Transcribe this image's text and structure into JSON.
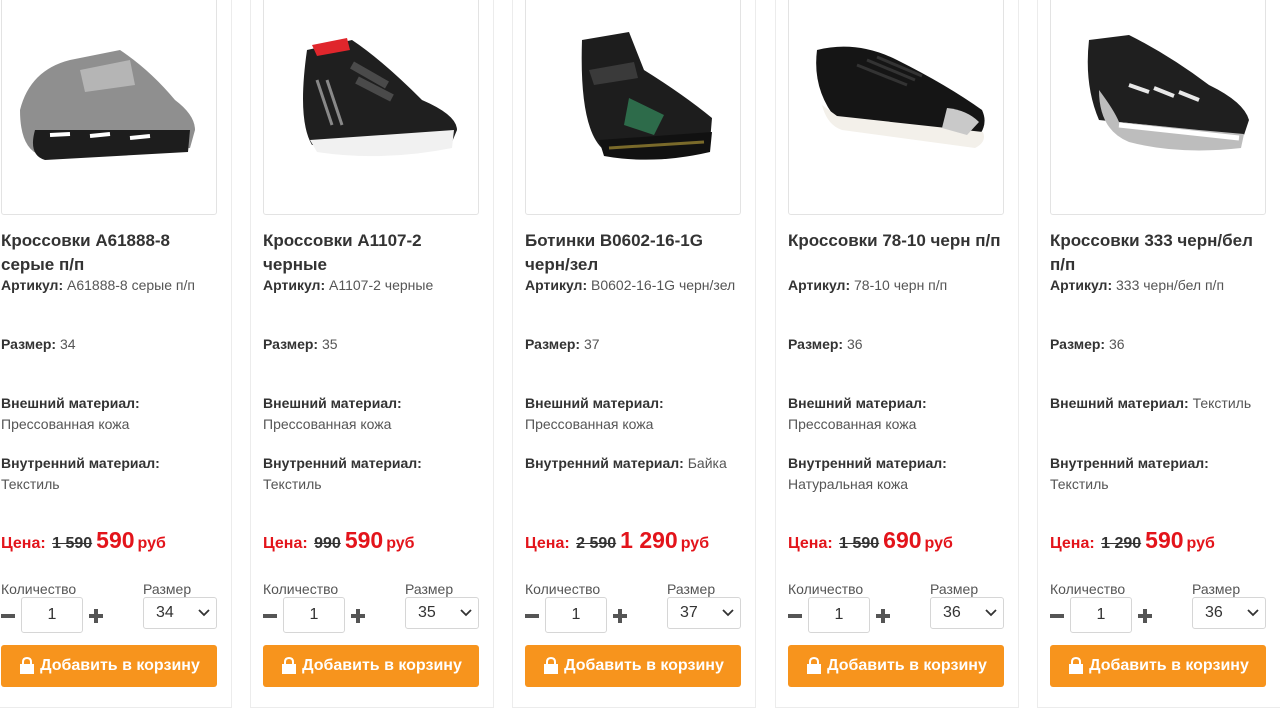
{
  "labels": {
    "article": "Артикул:",
    "size": "Размер:",
    "outer": "Внешний материал:",
    "inner": "Внутренний материал:",
    "price": "Цена:",
    "currency": "руб",
    "qty_label": "Количество",
    "size_label": "Размер",
    "add_to_cart": "Добавить в корзину",
    "bag_icon": "shopping-bag-icon"
  },
  "products": [
    {
      "title": "Кроссовки A61888-8 серые п/п",
      "article": "A61888-8 серые п/п",
      "size": "34",
      "outer": "Прессованная кожа",
      "inner": "Текстиль",
      "old_price": "1 590",
      "new_price": "590",
      "qty": "1",
      "selected_size": "34",
      "image_icon": "shoe-image",
      "color": "#8a8a8a"
    },
    {
      "title": "Кроссовки A1107-2 черные",
      "article": "A1107-2 черные",
      "size": "35",
      "outer": "Прессованная кожа",
      "inner": "Текстиль",
      "old_price": "990",
      "new_price": "590",
      "qty": "1",
      "selected_size": "35",
      "image_icon": "shoe-image",
      "color": "#222222"
    },
    {
      "title": "Ботинки B0602-16-1G черн/зел",
      "article": "B0602-16-1G черн/зел",
      "size": "37",
      "outer": "Прессованная кожа",
      "inner": "Байка",
      "old_price": "2 590",
      "new_price": "1 290",
      "qty": "1",
      "selected_size": "37",
      "image_icon": "boot-image",
      "color": "#1e1e1e"
    },
    {
      "title": "Кроссовки 78-10 черн п/п",
      "article": "78-10 черн п/п",
      "size": "36",
      "outer": "Прессованная кожа",
      "inner": "Натуральная кожа",
      "old_price": "1 590",
      "new_price": "690",
      "qty": "1",
      "selected_size": "36",
      "image_icon": "shoe-image",
      "color": "#1a1a1a"
    },
    {
      "title": "Кроссовки 333 черн/бел п/п",
      "article": "333 черн/бел п/п",
      "size": "36",
      "outer": "Текстиль",
      "inner": "Текстиль",
      "old_price": "1 290",
      "new_price": "590",
      "qty": "1",
      "selected_size": "36",
      "image_icon": "shoe-image",
      "color": "#2a2a2a"
    }
  ]
}
